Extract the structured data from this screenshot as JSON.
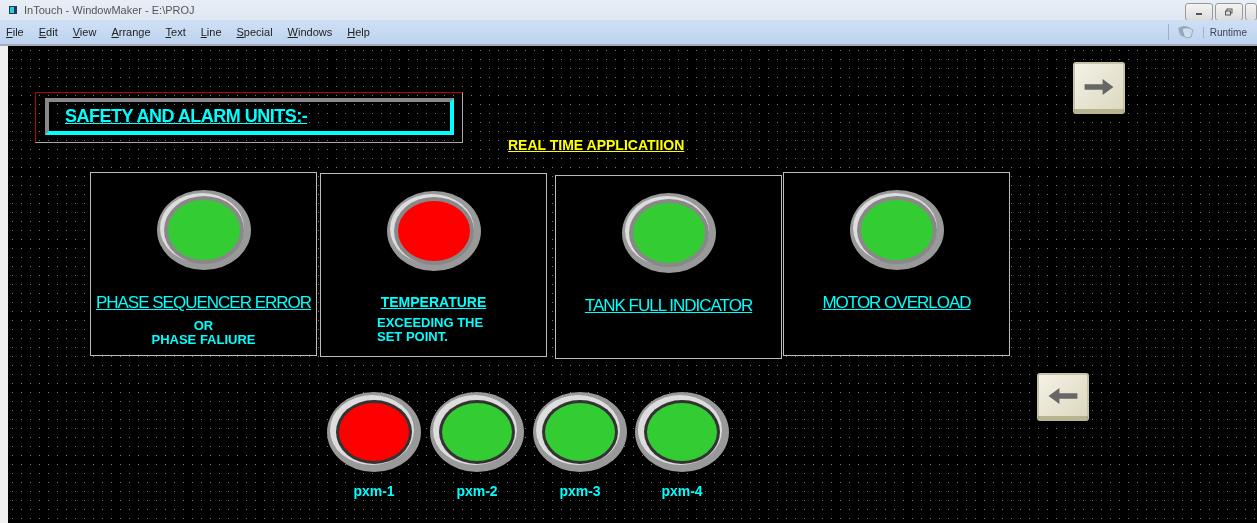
{
  "window": {
    "title": "InTouch - WindowMaker - E:\\PROJ"
  },
  "menu": [
    "File",
    "Edit",
    "View",
    "Arrange",
    "Text",
    "Line",
    "Special",
    "Windows",
    "Help"
  ],
  "mode": {
    "label": "Runtime"
  },
  "header": {
    "title": "SAFETY AND ALARM UNITS:-"
  },
  "subtitle": "REAL TIME APPLICATIION",
  "panels": [
    {
      "title": "PHASE SEQUENCER ERROR",
      "bold": false,
      "lamp": {
        "color": "#33cc33"
      },
      "notes": [
        "OR",
        "PHASE FALIURE"
      ]
    },
    {
      "title": "TEMPERATURE",
      "bold": true,
      "lamp": {
        "color": "#ff0000"
      },
      "notes": [
        "EXCEEDING THE",
        "SET POINT."
      ]
    },
    {
      "title": "TANK FULL INDICATOR",
      "bold": false,
      "lamp": {
        "color": "#33cc33"
      }
    },
    {
      "title": "MOTOR OVERLOAD",
      "bold": false,
      "lamp": {
        "color": "#33cc33"
      }
    }
  ],
  "pumps": [
    {
      "label": "pxm-1",
      "color": "#ff0000"
    },
    {
      "label": "pxm-2",
      "color": "#33cc33"
    },
    {
      "label": "pxm-3",
      "color": "#33cc33"
    },
    {
      "label": "pxm-4",
      "color": "#33cc33"
    }
  ]
}
